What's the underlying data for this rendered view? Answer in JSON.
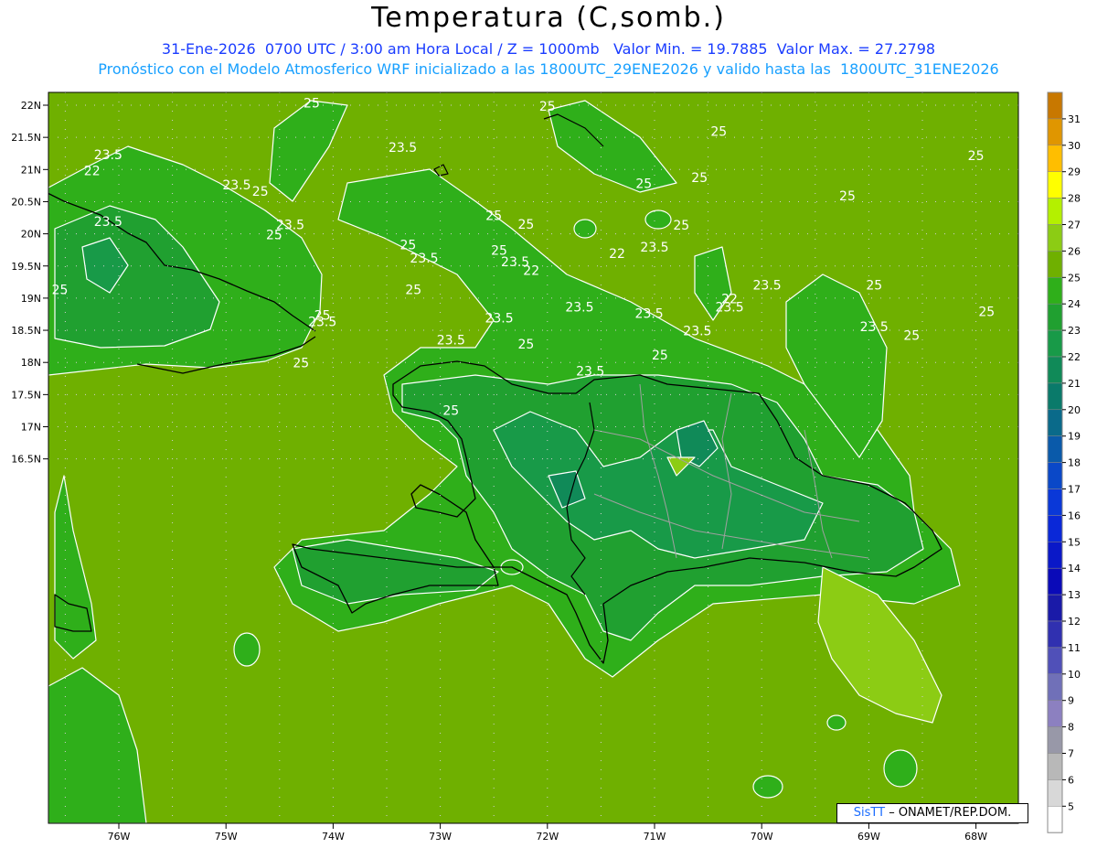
{
  "title": "Temperatura (C,somb.)",
  "subtitle_line1": "31-Ene-2026  0700 UTC / 3:00 am Hora Local / Z = 1000mb   Valor Min. = 19.7885  Valor Max. = 27.2798",
  "subtitle_line2": "Pronóstico con el Modelo Atmosferico WRF inicializado a las 1800UTC_29ENE2026 y valido hasta las  1800UTC_31ENE2026",
  "credit_logo": "SisTT",
  "credit_text": " – ONAMET/REP.DOM.",
  "map": {
    "lat_labels": [
      "22N",
      "21.5N",
      "21N",
      "20.5N",
      "20N",
      "19.5N",
      "19N",
      "18.5N",
      "18N",
      "17.5N",
      "17N",
      "16.5N"
    ],
    "lon_labels": [
      "76W",
      "75W",
      "74W",
      "73W",
      "72W",
      "71W",
      "70W",
      "69W",
      "68W"
    ],
    "colors": {
      "sea_25": "#6fb000",
      "band_24": "#2faf1a",
      "band_23": "#20a030",
      "band_22": "#189a48",
      "band_21": "#108a58",
      "band_26": "#8ccc14",
      "coast": "#000000",
      "borders": "#a0a0a0",
      "contour": "#ffffff"
    },
    "contour_labels": [
      {
        "text": "25",
        "lon": -74.2,
        "lat": 22.02
      },
      {
        "text": "25",
        "lon": -72.0,
        "lat": 21.97
      },
      {
        "text": "25",
        "lon": -70.4,
        "lat": 21.58
      },
      {
        "text": "25",
        "lon": -68.0,
        "lat": 21.2
      },
      {
        "text": "23.5",
        "lon": -76.1,
        "lat": 21.22
      },
      {
        "text": "22",
        "lon": -76.25,
        "lat": 20.97
      },
      {
        "text": "23.5",
        "lon": -73.35,
        "lat": 21.33
      },
      {
        "text": "23.5",
        "lon": -74.9,
        "lat": 20.75
      },
      {
        "text": "25",
        "lon": -74.68,
        "lat": 20.65
      },
      {
        "text": "25",
        "lon": -71.1,
        "lat": 20.77
      },
      {
        "text": "25",
        "lon": -70.58,
        "lat": 20.86
      },
      {
        "text": "25",
        "lon": -69.2,
        "lat": 20.58
      },
      {
        "text": "25",
        "lon": -72.5,
        "lat": 20.27
      },
      {
        "text": "25",
        "lon": -72.2,
        "lat": 20.14
      },
      {
        "text": "25",
        "lon": -70.75,
        "lat": 20.12
      },
      {
        "text": "23.5",
        "lon": -76.1,
        "lat": 20.18
      },
      {
        "text": "23.5",
        "lon": -74.4,
        "lat": 20.13
      },
      {
        "text": "25",
        "lon": -74.55,
        "lat": 19.97
      },
      {
        "text": "25",
        "lon": -73.3,
        "lat": 19.82
      },
      {
        "text": "23.5",
        "lon": -73.15,
        "lat": 19.61
      },
      {
        "text": "25",
        "lon": -72.45,
        "lat": 19.73
      },
      {
        "text": "22",
        "lon": -71.35,
        "lat": 19.68
      },
      {
        "text": "23.5",
        "lon": -71.0,
        "lat": 19.78
      },
      {
        "text": "23.5",
        "lon": -72.3,
        "lat": 19.55
      },
      {
        "text": "22",
        "lon": -72.15,
        "lat": 19.42
      },
      {
        "text": "25",
        "lon": -76.55,
        "lat": 19.12
      },
      {
        "text": "25",
        "lon": -73.25,
        "lat": 19.12
      },
      {
        "text": "23.5",
        "lon": -69.95,
        "lat": 19.19
      },
      {
        "text": "25",
        "lon": -68.95,
        "lat": 19.19
      },
      {
        "text": "22",
        "lon": -70.3,
        "lat": 18.98
      },
      {
        "text": "23.5",
        "lon": -71.7,
        "lat": 18.85
      },
      {
        "text": "23.5",
        "lon": -70.3,
        "lat": 18.85
      },
      {
        "text": "23.5",
        "lon": -71.05,
        "lat": 18.75
      },
      {
        "text": "25",
        "lon": -74.1,
        "lat": 18.72
      },
      {
        "text": "23.5",
        "lon": -74.1,
        "lat": 18.62
      },
      {
        "text": "23.5",
        "lon": -72.45,
        "lat": 18.68
      },
      {
        "text": "25",
        "lon": -67.9,
        "lat": 18.78
      },
      {
        "text": "23.5",
        "lon": -70.6,
        "lat": 18.48
      },
      {
        "text": "23.5",
        "lon": -68.95,
        "lat": 18.54
      },
      {
        "text": "25",
        "lon": -68.6,
        "lat": 18.41
      },
      {
        "text": "23.5",
        "lon": -72.9,
        "lat": 18.34
      },
      {
        "text": "25",
        "lon": -72.2,
        "lat": 18.27
      },
      {
        "text": "25",
        "lon": -70.95,
        "lat": 18.1
      },
      {
        "text": "25",
        "lon": -74.3,
        "lat": 17.98
      },
      {
        "text": "23.5",
        "lon": -71.6,
        "lat": 17.85
      },
      {
        "text": "25",
        "lon": -72.9,
        "lat": 17.24
      }
    ]
  },
  "legend": {
    "ticks": [
      "31",
      "30",
      "29",
      "28",
      "27",
      "26",
      "25",
      "24",
      "23",
      "22",
      "21",
      "20",
      "19",
      "18",
      "17",
      "16",
      "15",
      "14",
      "13",
      "12",
      "11",
      "10",
      "9",
      "8",
      "7",
      "6",
      "5"
    ],
    "colors": [
      "#c87800",
      "#e09600",
      "#ffbe00",
      "#ffff00",
      "#b4f000",
      "#8ccc14",
      "#6fb000",
      "#2faf1a",
      "#20a030",
      "#189a48",
      "#108a58",
      "#0a7a6a",
      "#0a6a8a",
      "#0a5aaa",
      "#0a48c8",
      "#0a38d8",
      "#0a28d8",
      "#0a18c8",
      "#0a0ab8",
      "#1a1aa8",
      "#3030b0",
      "#5050b8",
      "#7070b8",
      "#8c80c0",
      "#9898a8",
      "#b8b8b8",
      "#d8d8d8",
      "#ffffff"
    ]
  }
}
